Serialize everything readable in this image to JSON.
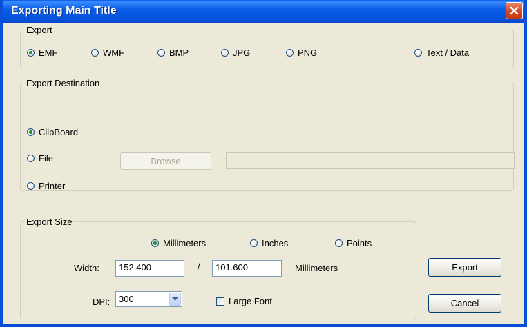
{
  "window": {
    "title": "Exporting Main Title"
  },
  "export_group": {
    "legend": "Export",
    "options": [
      {
        "label": "EMF",
        "checked": true
      },
      {
        "label": "WMF",
        "checked": false
      },
      {
        "label": "BMP",
        "checked": false
      },
      {
        "label": "JPG",
        "checked": false
      },
      {
        "label": "PNG",
        "checked": false
      },
      {
        "label": "Text / Data",
        "checked": false
      }
    ]
  },
  "destination_group": {
    "legend": "Export Destination",
    "options": [
      {
        "label": "ClipBoard",
        "checked": true
      },
      {
        "label": "File",
        "checked": false
      },
      {
        "label": "Printer",
        "checked": false
      }
    ],
    "browse_label": "Browse",
    "file_path": ""
  },
  "size_group": {
    "legend": "Export Size",
    "units": [
      {
        "label": "Millimeters",
        "checked": true
      },
      {
        "label": "Inches",
        "checked": false
      },
      {
        "label": "Points",
        "checked": false
      }
    ],
    "width_label": "Width:",
    "width_value": "152.400",
    "separator": "/",
    "height_value": "101.600",
    "unit_label": "Millimeters",
    "dpi_label": "DPI:",
    "dpi_value": "300",
    "large_font_label": "Large Font",
    "large_font_checked": false
  },
  "buttons": {
    "export": "Export",
    "cancel": "Cancel"
  },
  "icons": {
    "close": "close-icon",
    "dropdown": "chevron-down-icon"
  },
  "colors": {
    "titlebar": "#0a5ee8",
    "close": "#d24a25",
    "dialog_bg": "#ece9d8",
    "radio_checked": "#21a121"
  }
}
